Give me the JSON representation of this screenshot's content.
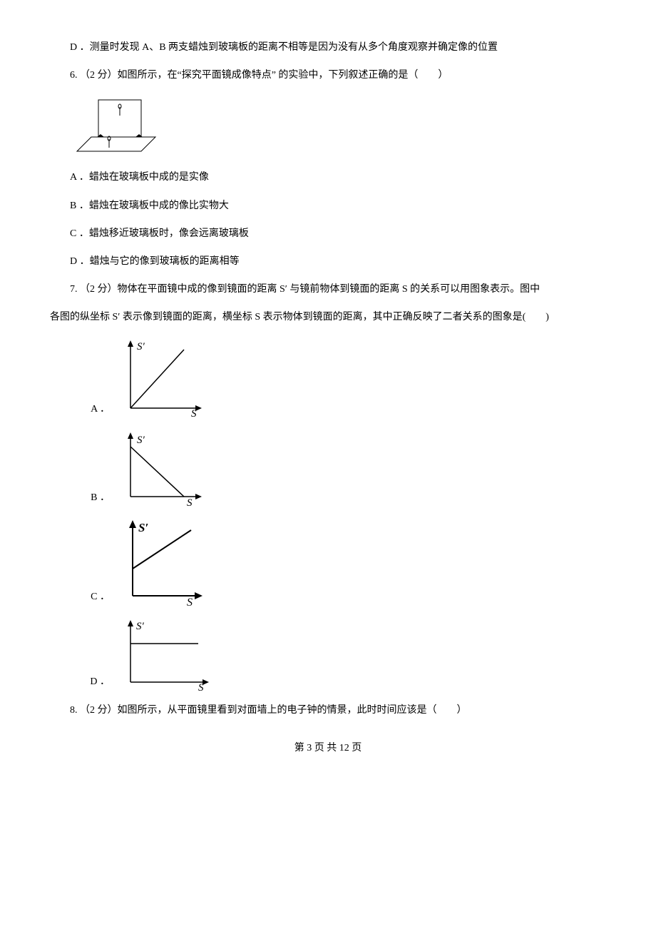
{
  "q5": {
    "optD": "D ．测量时发现 A、B 两支蜡烛到玻璃板的距离不相等是因为没有从多个角度观察并确定像的位置"
  },
  "q6": {
    "stem": "6. （2 分）如图所示，在“探究平面镜成像特点” 的实验中，下列叙述正确的是（　　）",
    "optA": "A ．蜡烛在玻璃板中成的是实像",
    "optB": "B ．蜡烛在玻璃板中成的像比实物大",
    "optC": "C ．蜡烛移近玻璃板时，像会远离玻璃板",
    "optD": "D ．蜡烛与它的像到玻璃板的距离相等"
  },
  "q7": {
    "stem1": "7. （2 分）物体在平面镜中成的像到镜面的距离 S′ 与镜前物体到镜面的距离 S 的关系可以用图象表示。图中",
    "stem2": "各图的纵坐标 S′ 表示像到镜面的距离，横坐标 S 表示物体到镜面的距离，其中正确反映了二者关系的图象是(　　)",
    "labelA": "A ．",
    "labelB": "B ．",
    "labelC": "C ．",
    "labelD": "D ．",
    "ylab": "S′",
    "xlab": "S"
  },
  "q8": {
    "stem": "8. （2 分）如图所示，从平面镜里看到对面墙上的电子钟的情景，此时时间应该是（　　）"
  },
  "footer": {
    "text": "第 3 页 共 12 页"
  },
  "chart_data": [
    {
      "type": "line",
      "option": "A",
      "xlabel": "S",
      "ylabel": "S′",
      "points": [
        [
          0,
          0
        ],
        [
          1,
          1
        ]
      ],
      "description": "straight line through origin, positive slope (S' = S)"
    },
    {
      "type": "line",
      "option": "B",
      "xlabel": "S",
      "ylabel": "S′",
      "points": [
        [
          0,
          1
        ],
        [
          1,
          0
        ]
      ],
      "description": "straight line from positive y-intercept down to x-axis, negative slope"
    },
    {
      "type": "line",
      "option": "C",
      "xlabel": "S",
      "ylabel": "S′",
      "points": [
        [
          0,
          0.4
        ],
        [
          1,
          1
        ]
      ],
      "description": "straight line with positive y-intercept and positive slope"
    },
    {
      "type": "line",
      "option": "D",
      "xlabel": "S",
      "ylabel": "S′",
      "points": [
        [
          0,
          0.5
        ],
        [
          1,
          0.5
        ]
      ],
      "description": "horizontal line, constant S'"
    }
  ]
}
